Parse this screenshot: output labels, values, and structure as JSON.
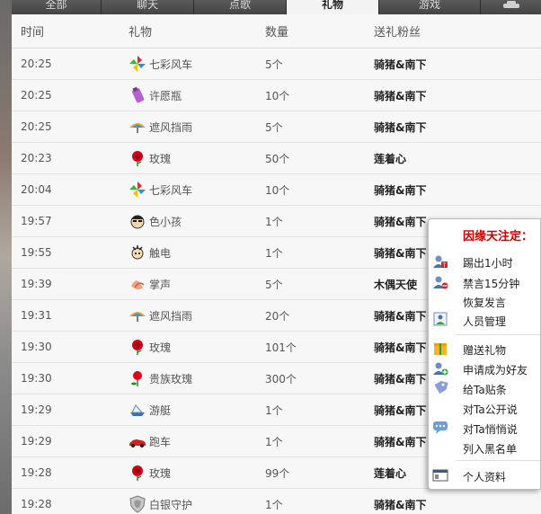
{
  "tabs": [
    {
      "label": "全部",
      "active": false
    },
    {
      "label": "聊天",
      "active": false
    },
    {
      "label": "点歌",
      "active": false
    },
    {
      "label": "礼物",
      "active": true
    },
    {
      "label": "游戏",
      "active": false
    }
  ],
  "header": {
    "time": "时间",
    "gift": "礼物",
    "count": "数量",
    "fan": "送礼粉丝"
  },
  "rows": [
    {
      "time": "20:25",
      "gift": "七彩风车",
      "icon": "pinwheel-icon",
      "count": "5个",
      "fan": "骑猪&南下"
    },
    {
      "time": "20:25",
      "gift": "许愿瓶",
      "icon": "wish-bottle-icon",
      "count": "10个",
      "fan": "骑猪&南下"
    },
    {
      "time": "20:25",
      "gift": "遮风挡雨",
      "icon": "umbrella-icon",
      "count": "5个",
      "fan": "骑猪&南下"
    },
    {
      "time": "20:23",
      "gift": "玫瑰",
      "icon": "rose-icon",
      "count": "50个",
      "fan": "莲着心"
    },
    {
      "time": "20:04",
      "gift": "七彩风车",
      "icon": "pinwheel-icon",
      "count": "10个",
      "fan": "骑猪&南下"
    },
    {
      "time": "19:57",
      "gift": "色小孩",
      "icon": "naughty-kid-icon",
      "count": "1个",
      "fan": "骑猪&南下"
    },
    {
      "time": "19:55",
      "gift": "触电",
      "icon": "electric-shock-icon",
      "count": "1个",
      "fan": "骑猪&南下"
    },
    {
      "time": "19:39",
      "gift": "掌声",
      "icon": "clapping-icon",
      "count": "5个",
      "fan": "木偶天使"
    },
    {
      "time": "19:31",
      "gift": "遮风挡雨",
      "icon": "umbrella-icon",
      "count": "20个",
      "fan": "骑猪&南下"
    },
    {
      "time": "19:30",
      "gift": "玫瑰",
      "icon": "rose-icon",
      "count": "101个",
      "fan": "骑猪&南下"
    },
    {
      "time": "19:30",
      "gift": "贵族玫瑰",
      "icon": "noble-rose-icon",
      "count": "300个",
      "fan": "骑猪&南下"
    },
    {
      "time": "19:29",
      "gift": "游艇",
      "icon": "yacht-icon",
      "count": "1个",
      "fan": "骑猪&南下"
    },
    {
      "time": "19:29",
      "gift": "跑车",
      "icon": "sports-car-icon",
      "count": "1个",
      "fan": "骑猪&南下"
    },
    {
      "time": "19:28",
      "gift": "玫瑰",
      "icon": "rose-icon",
      "count": "99个",
      "fan": "莲着心"
    },
    {
      "time": "19:28",
      "gift": "白银守护",
      "icon": "silver-guard-icon",
      "count": "1个",
      "fan": "骑猪&南下"
    }
  ],
  "context_menu": {
    "title": "因缘天注定：",
    "items": [
      {
        "label": "踢出1小时",
        "icon": "kick-user-icon"
      },
      {
        "label": "禁言15分钟",
        "icon": "mute-user-icon"
      },
      {
        "label": "恢复发言",
        "icon": ""
      },
      {
        "label": "人员管理",
        "icon": "manage-users-icon"
      },
      {
        "label": "赠送礼物",
        "icon": "gift-box-icon"
      },
      {
        "label": "申请成为好友",
        "icon": "add-friend-icon"
      },
      {
        "label": "给Ta贴条",
        "icon": "tag-icon"
      },
      {
        "label": "对Ta公开说",
        "icon": ""
      },
      {
        "label": "对Ta悄悄说",
        "icon": "chat-bubble-icon"
      },
      {
        "label": "列入黑名单",
        "icon": ""
      },
      {
        "label": "个人资料",
        "icon": "profile-card-icon"
      }
    ]
  },
  "colors": {
    "menu_title": "#d40000",
    "tab_bar": "#4a4a4a",
    "active_tab": "#f3f3f3"
  }
}
